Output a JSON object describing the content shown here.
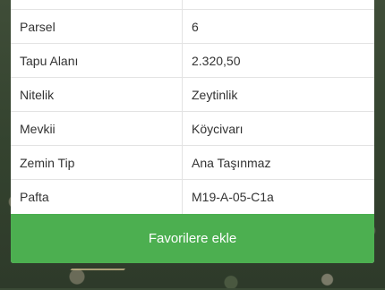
{
  "details": {
    "rows": [
      {
        "label": "",
        "value": ""
      },
      {
        "label": "Parsel",
        "value": "6"
      },
      {
        "label": "Tapu Alanı",
        "value": "2.320,50"
      },
      {
        "label": "Nitelik",
        "value": "Zeytinlik"
      },
      {
        "label": "Mevkii",
        "value": "Köycivarı"
      },
      {
        "label": "Zemin Tip",
        "value": "Ana Taşınmaz"
      },
      {
        "label": "Pafta",
        "value": "M19-A-05-C1a"
      }
    ]
  },
  "actions": {
    "favorite_label": "Favorilere ekle",
    "favorite_color": "#4caf50"
  }
}
